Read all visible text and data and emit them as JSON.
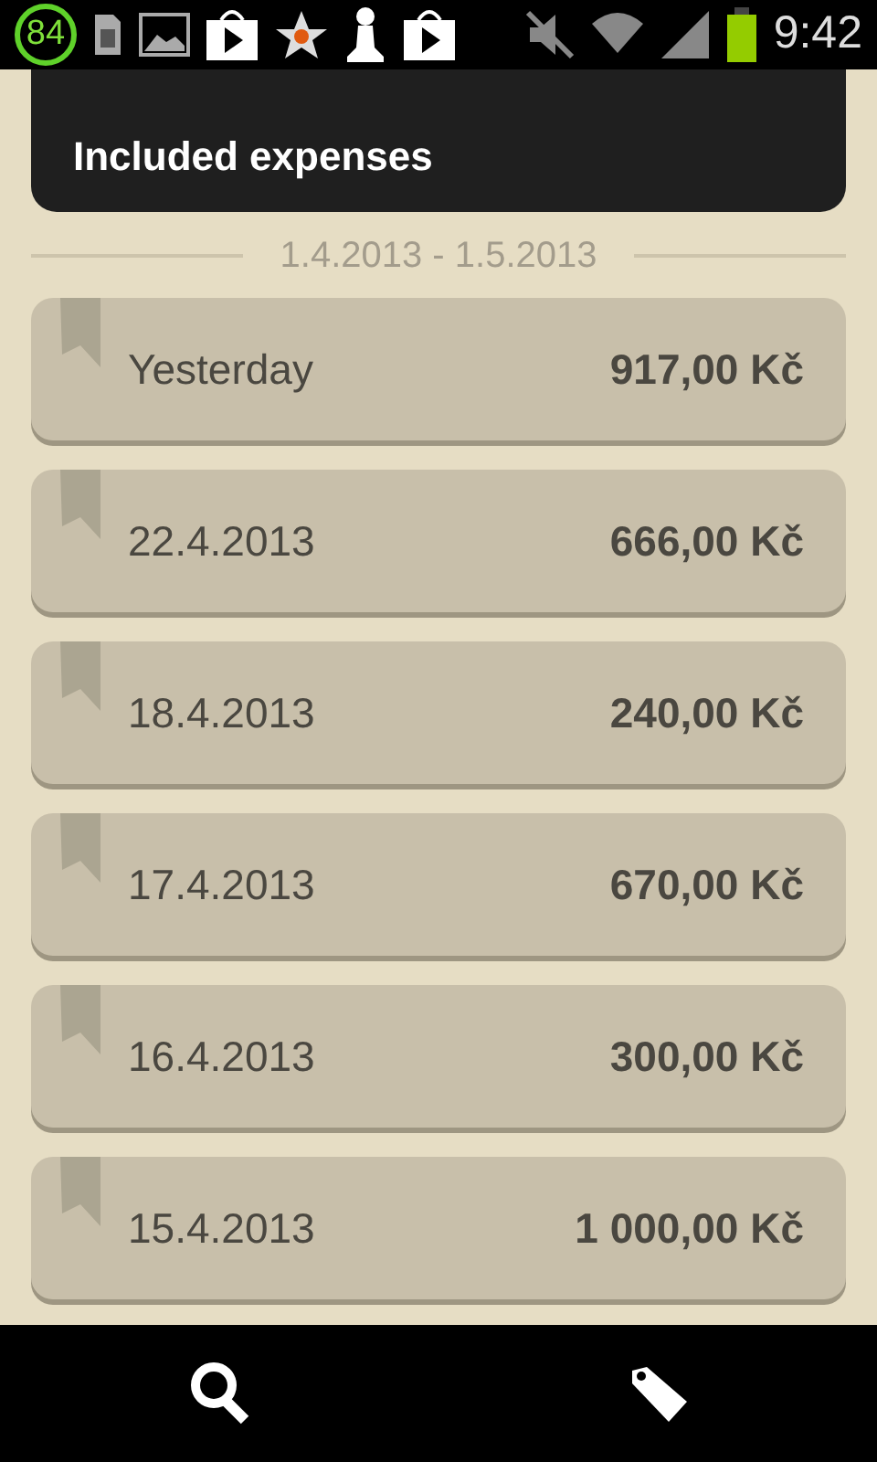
{
  "status_bar": {
    "badge": "84",
    "time": "9:42"
  },
  "header": {
    "title": "Included expenses"
  },
  "period": "1.4.2013 - 1.5.2013",
  "expenses": [
    {
      "date": "Yesterday",
      "amount": "917,00 Kč"
    },
    {
      "date": "22.4.2013",
      "amount": "666,00 Kč"
    },
    {
      "date": "18.4.2013",
      "amount": "240,00 Kč"
    },
    {
      "date": "17.4.2013",
      "amount": "670,00 Kč"
    },
    {
      "date": "16.4.2013",
      "amount": "300,00 Kč"
    },
    {
      "date": "15.4.2013",
      "amount": "1 000,00 Kč"
    }
  ]
}
